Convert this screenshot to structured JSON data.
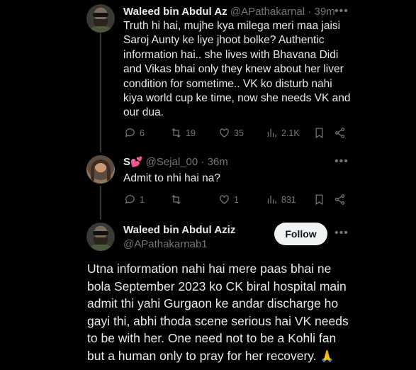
{
  "tweet1": {
    "display_name": "Waleed bin Abdul Az",
    "handle": "@APathakarnal",
    "separator": "·",
    "time": "39m",
    "lines": [
      "Truth hi hai, mujhe kya milega meri maa jaisi",
      "Saroj Aunty ke liye jhoot bolke? Authentic",
      "information hai.. she lives with Bhavana Didi",
      "and Vikas bhai only they knew about her liver",
      "condition for sometime.. VK ko disturb nahi",
      "kiya world cup ke time, now she needs VK and",
      "our dua."
    ],
    "replies": "6",
    "reposts": "19",
    "likes": "35",
    "views": "2.1K"
  },
  "tweet2": {
    "display_name": "S",
    "name_emoji": "💕",
    "handle": "@Sejal_00",
    "separator": "·",
    "time": "36m",
    "text": "Admit to nhi hai na?",
    "replies": "1",
    "reposts": "",
    "likes": "1",
    "views": "831"
  },
  "tweet3": {
    "display_name": "Waleed bin Abdul Aziz",
    "handle": "@APathakarnab1",
    "follow_label": "Follow",
    "lines": [
      "Utna information nahi hai mere paas bhai ne",
      "bola September 2023 ko CK biral hospital main",
      "admit thi yahi Gurgaon ke andar discharge ho",
      "gayi thi, abhi thoda scene serious hai VK needs",
      "to be with her. One need not to be a Kohli fan",
      "but a human only to pray for her recovery."
    ],
    "emoji": "🙏"
  },
  "more_icon": "•••",
  "colors": {
    "background": "#000000",
    "text": "#e7e9ea",
    "muted": "#71767b",
    "follow_bg": "#eff3f4"
  }
}
